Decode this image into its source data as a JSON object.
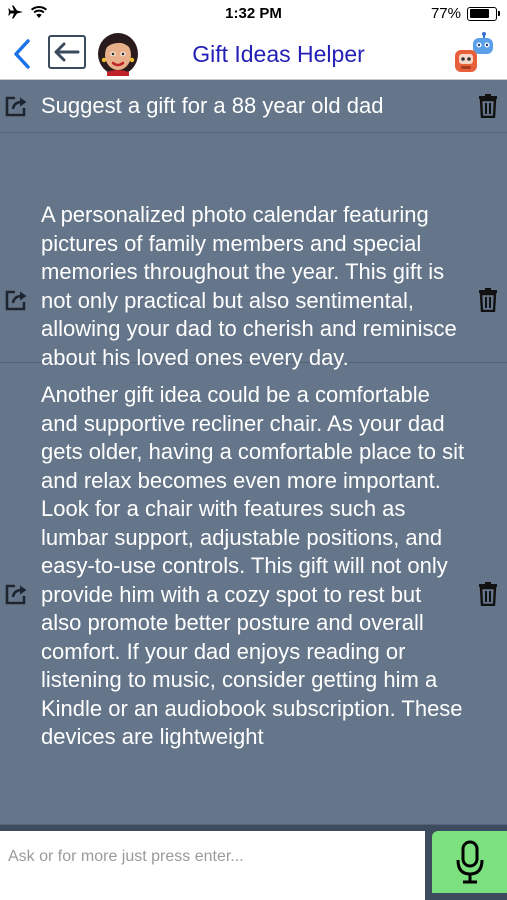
{
  "status_bar": {
    "time": "1:32 PM",
    "battery_percent": "77%",
    "battery_level": 0.77
  },
  "nav": {
    "title": "Gift Ideas Helper"
  },
  "messages": [
    {
      "text": "Suggest a gift for a 88 year old dad"
    },
    {
      "text": "A personalized photo calendar featuring pictures of family members and special memories throughout the year. This gift is not only practical but also sentimental, allowing your dad to cherish and reminisce about his loved ones every day."
    },
    {
      "text": "Another gift idea could be a comfortable and supportive recliner chair. As your dad gets older, having a comfortable place to sit and relax becomes even more important. Look for a chair with features such as lumbar support, adjustable positions, and easy-to-use controls. This gift will not only provide him with a cozy spot to rest but also promote better posture and overall comfort.  If your dad enjoys reading or listening to music, consider getting him a Kindle or an audiobook subscription. These devices are lightweight"
    }
  ],
  "input": {
    "placeholder": "Ask or for more just press enter...",
    "value": ""
  },
  "colors": {
    "accent": "#2420b5",
    "background": "#66768a",
    "mic_button": "#7be07d"
  },
  "icons": [
    "airplane-icon",
    "wifi-icon",
    "battery-icon",
    "back-chevron-icon",
    "back-arrow-icon",
    "avatar",
    "robot-icon",
    "share-icon",
    "trash-icon",
    "microphone-icon"
  ]
}
